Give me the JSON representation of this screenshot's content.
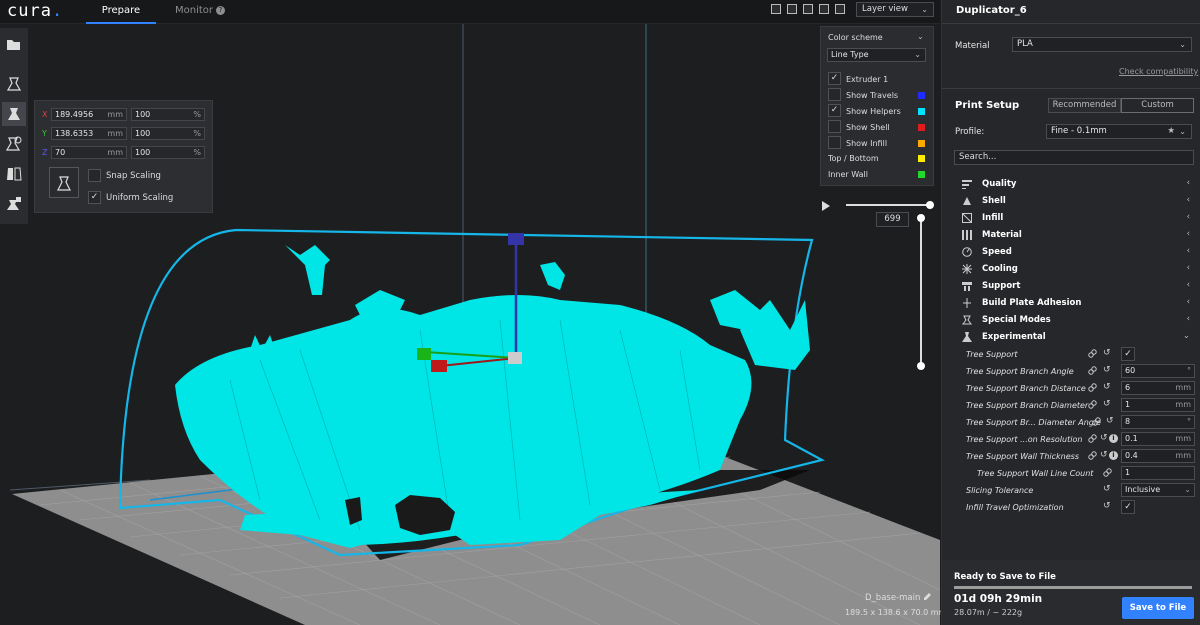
{
  "header": {
    "logo": "cura",
    "tabs": {
      "prepare": "Prepare",
      "monitor": "Monitor"
    },
    "view_mode": "Layer view"
  },
  "scale_panel": {
    "x": {
      "axis": "X",
      "value": "189.4956",
      "unit": "mm",
      "percent": "100",
      "percent_unit": "%"
    },
    "y": {
      "axis": "Y",
      "value": "138.6353",
      "unit": "mm",
      "percent": "100",
      "percent_unit": "%"
    },
    "z": {
      "axis": "Z",
      "value": "70",
      "unit": "mm",
      "percent": "100",
      "percent_unit": "%"
    },
    "snap_scaling": "Snap Scaling",
    "uniform_scaling": "Uniform Scaling",
    "uniform_checked": true
  },
  "color_panel": {
    "title": "Color scheme",
    "scheme": "Line Type",
    "items": [
      {
        "label": "Extruder 1",
        "checked": true
      },
      {
        "label": "Show Travels",
        "checked": false,
        "color": "#1f2bff"
      },
      {
        "label": "Show Helpers",
        "checked": true,
        "color": "#00e5ff"
      },
      {
        "label": "Show Shell",
        "checked": false,
        "color": "#e01b1b"
      },
      {
        "label": "Show Infill",
        "checked": false,
        "color": "#ffaa00"
      },
      {
        "label": "Top / Bottom",
        "color": "#ffee00"
      },
      {
        "label": "Inner Wall",
        "color": "#22d82a"
      }
    ]
  },
  "layer": {
    "current": "699",
    "level_fraction": 1.0
  },
  "model": {
    "name": "D_base-main",
    "dims": "189.5 x 138.6 x 70.0 mm"
  },
  "right_panel": {
    "printer": "Duplicator_6",
    "material_label": "Material",
    "material": "PLA",
    "check_compat": "Check compatibility",
    "print_setup": "Print Setup",
    "mode_recommended": "Recommended",
    "mode_custom": "Custom",
    "profile_label": "Profile:",
    "profile": "Fine - 0.1mm",
    "search_placeholder": "Search...",
    "categories": [
      {
        "label": "Quality",
        "icon": "quality-icon"
      },
      {
        "label": "Shell",
        "icon": "shell-icon"
      },
      {
        "label": "Infill",
        "icon": "infill-icon"
      },
      {
        "label": "Material",
        "icon": "material-icon"
      },
      {
        "label": "Speed",
        "icon": "speed-icon"
      },
      {
        "label": "Cooling",
        "icon": "cooling-icon"
      },
      {
        "label": "Support",
        "icon": "support-icon"
      },
      {
        "label": "Build Plate Adhesion",
        "icon": "adhesion-icon"
      },
      {
        "label": "Special Modes",
        "icon": "special-modes-icon"
      },
      {
        "label": "Experimental",
        "icon": "experimental-icon"
      }
    ],
    "settings": [
      {
        "label": "Tree Support",
        "type": "check",
        "value": "✓"
      },
      {
        "label": "Tree Support Branch Angle",
        "value": "60",
        "unit": "°"
      },
      {
        "label": "Tree Support Branch Distance",
        "value": "6",
        "unit": "mm"
      },
      {
        "label": "Tree Support Branch Diameter",
        "value": "1",
        "unit": "mm"
      },
      {
        "label": "Tree Support Br... Diameter Angle",
        "value": "8",
        "unit": "°"
      },
      {
        "label": "Tree Support ...on Resolution",
        "value": "0.1",
        "unit": "mm",
        "info": true
      },
      {
        "label": "Tree Support Wall Thickness",
        "value": "0.4",
        "unit": "mm",
        "info": true
      },
      {
        "label": "Tree Support Wall Line Count",
        "value": "1",
        "unit": "",
        "indent": true
      },
      {
        "label": "Slicing Tolerance",
        "value": "Inclusive",
        "type": "select"
      },
      {
        "label": "Infill Travel Optimization",
        "type": "check",
        "value": "✓"
      }
    ],
    "ready": "Ready to Save to File",
    "progress": 1.0,
    "time": "01d 09h 29min",
    "usage": "28.07m / ~ 222g",
    "save_button": "Save to File"
  }
}
